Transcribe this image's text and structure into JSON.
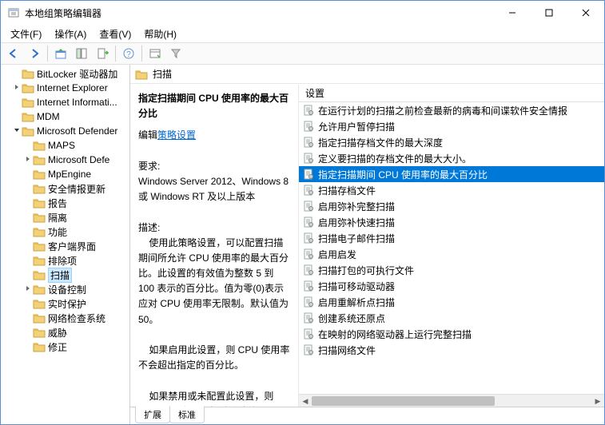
{
  "window": {
    "title": "本地组策略编辑器"
  },
  "menu": {
    "file": "文件(F)",
    "action": "操作(A)",
    "view": "查看(V)",
    "help": "帮助(H)"
  },
  "tree": {
    "items": [
      {
        "label": "BitLocker 驱动器加",
        "depth": 1,
        "expand": ""
      },
      {
        "label": "Internet Explorer",
        "depth": 1,
        "expand": ">"
      },
      {
        "label": "Internet Informati...",
        "depth": 1,
        "expand": ""
      },
      {
        "label": "MDM",
        "depth": 1,
        "expand": ""
      },
      {
        "label": "Microsoft Defender",
        "depth": 1,
        "expand": "v"
      },
      {
        "label": "MAPS",
        "depth": 2,
        "expand": ""
      },
      {
        "label": "Microsoft Defe",
        "depth": 2,
        "expand": ">"
      },
      {
        "label": "MpEngine",
        "depth": 2,
        "expand": ""
      },
      {
        "label": "安全情报更新",
        "depth": 2,
        "expand": ""
      },
      {
        "label": "报告",
        "depth": 2,
        "expand": ""
      },
      {
        "label": "隔离",
        "depth": 2,
        "expand": ""
      },
      {
        "label": "功能",
        "depth": 2,
        "expand": ""
      },
      {
        "label": "客户端界面",
        "depth": 2,
        "expand": ""
      },
      {
        "label": "排除项",
        "depth": 2,
        "expand": ""
      },
      {
        "label": "扫描",
        "depth": 2,
        "expand": "",
        "selected": true
      },
      {
        "label": "设备控制",
        "depth": 2,
        "expand": ">"
      },
      {
        "label": "实时保护",
        "depth": 2,
        "expand": ""
      },
      {
        "label": "网络检查系统",
        "depth": 2,
        "expand": ""
      },
      {
        "label": "威胁",
        "depth": 2,
        "expand": ""
      },
      {
        "label": "修正",
        "depth": 2,
        "expand": ""
      }
    ]
  },
  "header": {
    "title": "扫描"
  },
  "detail": {
    "title": "指定扫描期间 CPU 使用率的最大百分比",
    "editLabel": "编辑",
    "editLink": "策略设置",
    "reqLabel": "要求:",
    "reqText": "Windows Server 2012、Windows 8 或 Windows RT 及以上版本",
    "descLabel": "描述:",
    "descText": "    使用此策略设置，可以配置扫描期间所允许 CPU 使用率的最大百分比。此设置的有效值为整数 5 到 100 表示的百分比。值为零(0)表示应对 CPU 使用率无限制。默认值为 50。",
    "para2": "    如果启用此设置，则 CPU 使用率不会超出指定的百分比。",
    "para3": "    如果禁用或未配置此设置，则 CPU 使用率不会超过默认值。"
  },
  "listHeader": "设置",
  "list": [
    {
      "label": "在运行计划的扫描之前检查最新的病毒和间谍软件安全情报"
    },
    {
      "label": "允许用户暂停扫描"
    },
    {
      "label": "指定扫描存档文件的最大深度"
    },
    {
      "label": "定义要扫描的存档文件的最大大小。"
    },
    {
      "label": "指定扫描期间 CPU 使用率的最大百分比",
      "selected": true
    },
    {
      "label": "扫描存档文件"
    },
    {
      "label": "启用弥补完整扫描"
    },
    {
      "label": "启用弥补快速扫描"
    },
    {
      "label": "扫描电子邮件扫描"
    },
    {
      "label": "启用启发"
    },
    {
      "label": "扫描打包的可执行文件"
    },
    {
      "label": "扫描可移动驱动器"
    },
    {
      "label": "启用重解析点扫描"
    },
    {
      "label": "创建系统还原点"
    },
    {
      "label": "在映射的网络驱动器上运行完整扫描"
    },
    {
      "label": "扫描网络文件"
    }
  ],
  "tabs": {
    "extended": "扩展",
    "standard": "标准"
  }
}
